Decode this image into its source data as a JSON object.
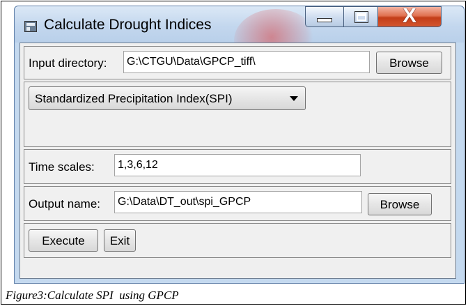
{
  "window": {
    "title": "Calculate Drought Indices",
    "icon": "app-window-icon",
    "controls": {
      "minimize_icon": "minimize-icon",
      "maximize_icon": "maximize-icon",
      "close_glyph": "X"
    }
  },
  "input": {
    "label": "Input directory:",
    "value": "G:\\CTGU\\Data\\GPCP_tiff\\",
    "browse_label": "Browse"
  },
  "index": {
    "selected": "Standardized Precipitation Index(SPI)",
    "arrow_icon": "dropdown-arrow-icon"
  },
  "time_scales": {
    "label": "Time scales:",
    "value": "1,3,6,12"
  },
  "output": {
    "label": "Output name:",
    "value": "G:\\Data\\DT_out\\spi_GPCP",
    "browse_label": "Browse"
  },
  "actions": {
    "execute_label": "Execute",
    "exit_label": "Exit"
  },
  "caption": "Figure3:Calculate SPI  using GPCP",
  "colors": {
    "title_bar": "#c3d7ee",
    "close_button": "#c33d18",
    "client_bg": "#f0f0f0"
  }
}
